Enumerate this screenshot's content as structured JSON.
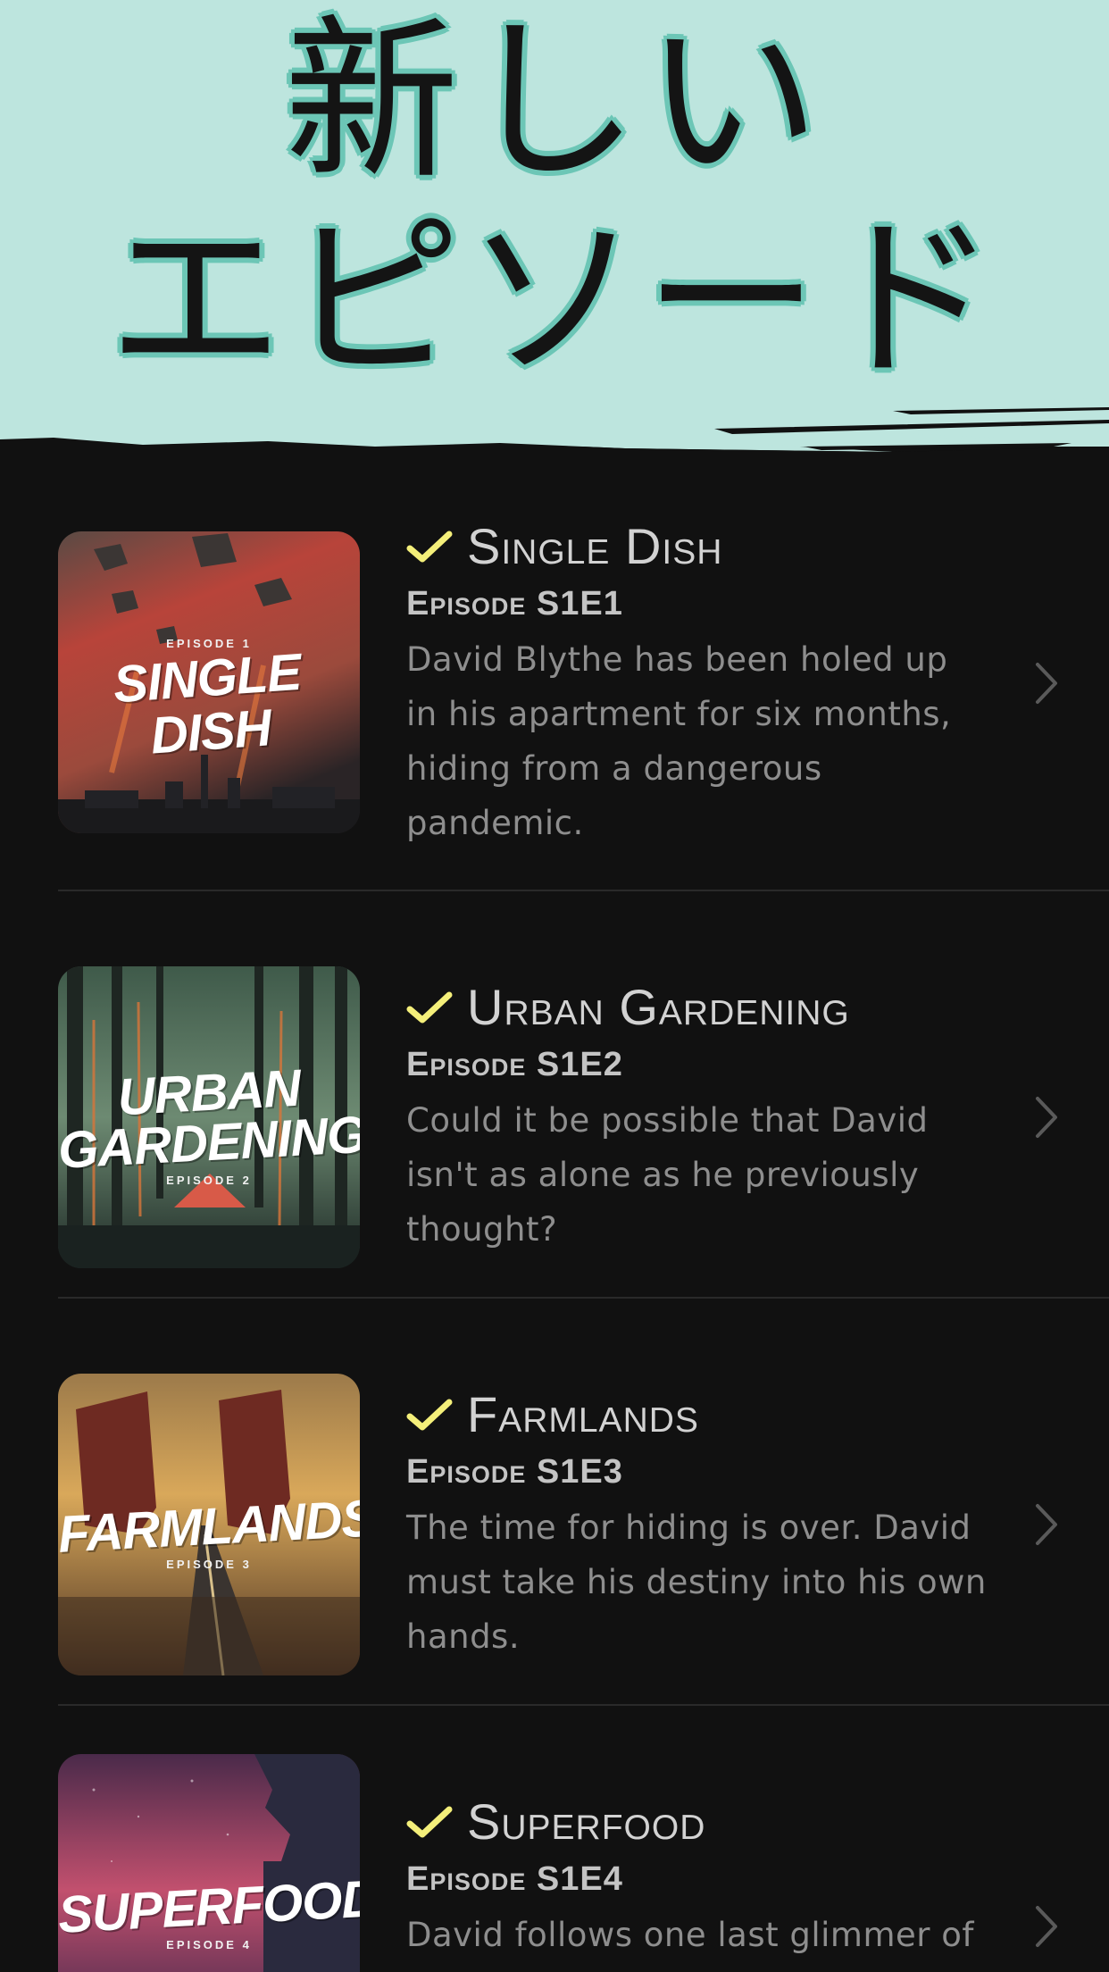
{
  "header": {
    "title_line1": "新しい",
    "title_line2": "エピソード"
  },
  "colors": {
    "header_bg": "#bde5de",
    "header_outline": "#6cc6b6",
    "list_bg": "#111111",
    "check": "#f4ef7a",
    "title_text": "#d2d2d2",
    "desc_text": "#8e8e8e"
  },
  "episodes": [
    {
      "title": "Single Dish",
      "code": "Episode S1E1",
      "description": "David Blythe has been holed up in his apartment for six months, hiding from a dangerous pandemic.",
      "art_title": "Single Dish",
      "art_episode": "Episode 1",
      "watched": true,
      "icon": "check-icon"
    },
    {
      "title": "Urban Gardening",
      "code": "Episode S1E2",
      "description": "Could it be possible that David isn't as alone as he previously thought?",
      "art_title_line1": "Urban",
      "art_title_line2": "Gardening",
      "art_episode": "Episode 2",
      "watched": true,
      "icon": "check-icon"
    },
    {
      "title": "Farmlands",
      "code": "Episode S1E3",
      "description": "The time for hiding is over. David must take his destiny into his own hands.",
      "art_title": "Farmlands",
      "art_episode": "Episode 3",
      "watched": true,
      "icon": "check-icon"
    },
    {
      "title": "Superfood",
      "code": "Episode S1E4",
      "description": "David follows one last glimmer of",
      "art_title": "Superfood",
      "art_episode": "Episode 4",
      "watched": true,
      "icon": "check-icon"
    }
  ]
}
